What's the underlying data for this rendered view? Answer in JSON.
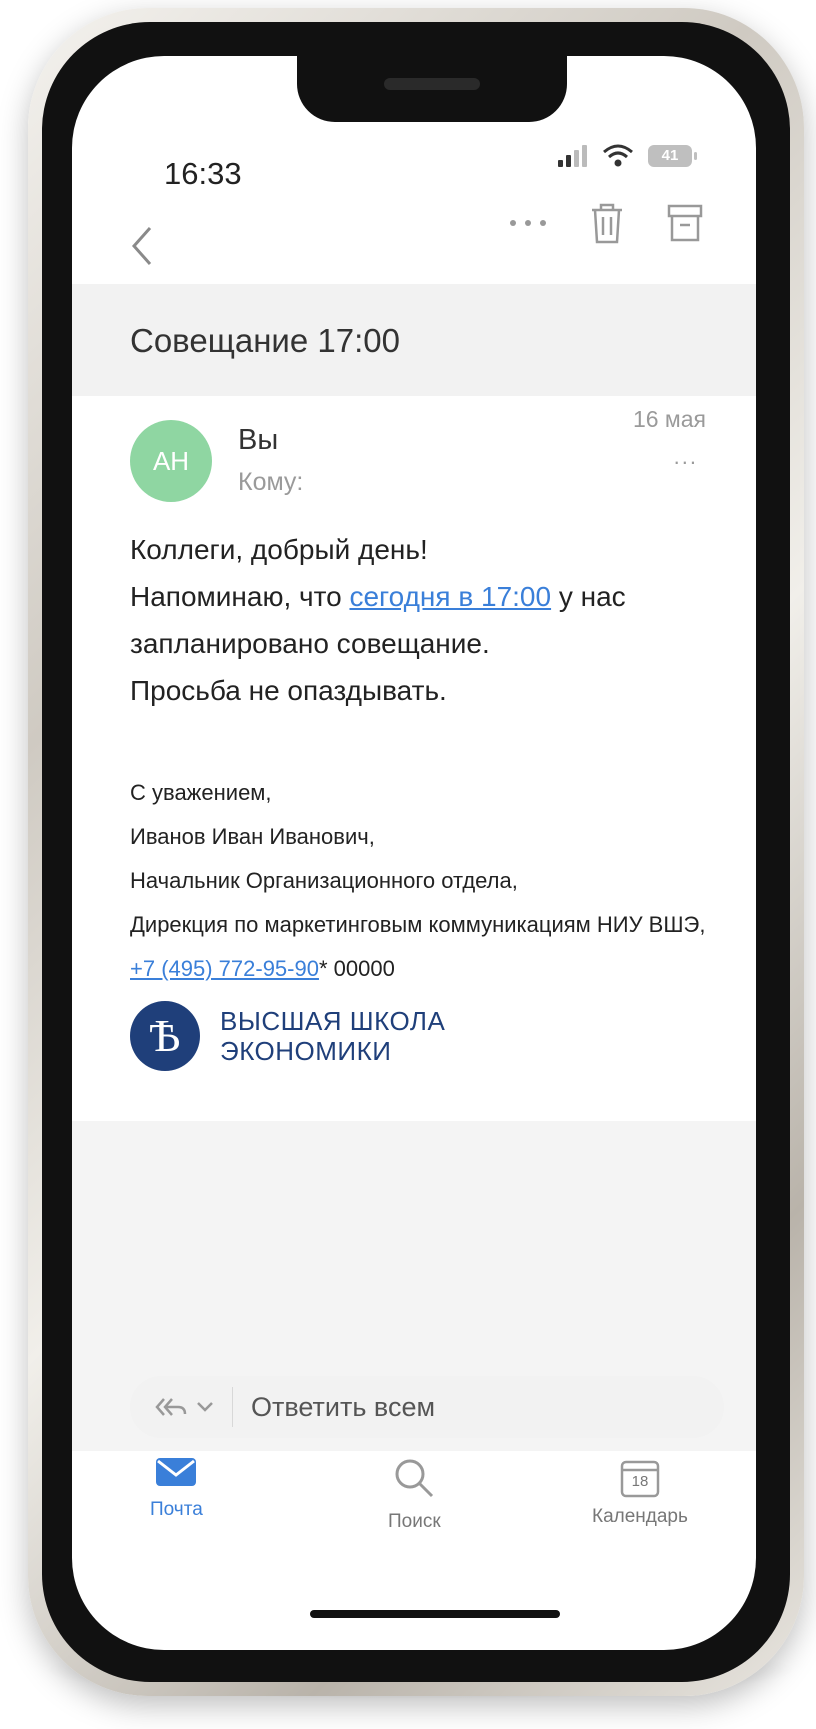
{
  "status_bar": {
    "time": "16:33",
    "battery": "41"
  },
  "message": {
    "subject": "Совещание 17:00",
    "avatar_initials": "AH",
    "sender": "Вы",
    "to_label": "Кому:",
    "date": "16 мая",
    "more": "...",
    "body": {
      "line1": "Коллеги, добрый день!",
      "line2_before": "Напоминаю, что ",
      "line2_link": "сегодня в 17:00",
      "line2_after": " у нас",
      "line3": "запланировано совещание.",
      "line4": "Просьба не опаздывать."
    },
    "signature": {
      "greeting": "С уважением,",
      "name": "Иванов Иван Иванович,",
      "position": "Начальник Организационного отдела,",
      "department": "Дирекция по маркетинговым коммуникациям НИУ ВШЭ,",
      "phone": "+7 (495) 772-95-90",
      "extension": "* 00000"
    },
    "logo": {
      "line1": "ВЫСШАЯ ШКОЛА",
      "line2": "ЭКОНОМИКИ"
    }
  },
  "reply_bar": {
    "label": "Ответить всем"
  },
  "tabs": [
    {
      "label": "Почта",
      "active": true
    },
    {
      "label": "Поиск",
      "active": false
    },
    {
      "label": "Календарь",
      "active": false,
      "icon_number": "18"
    }
  ],
  "colors": {
    "accent": "#3a7fd9",
    "avatar": "#8fd6a2",
    "logo": "#1f3f7a"
  }
}
